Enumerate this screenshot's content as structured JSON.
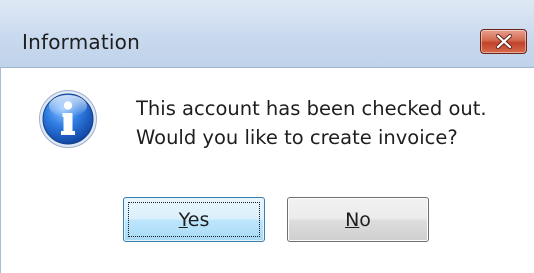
{
  "window": {
    "title": "Information",
    "close_icon": "close-x-icon"
  },
  "message": {
    "icon": "information-icon",
    "line1": "This account has been checked out.",
    "line2": "Would you like to create invoice?"
  },
  "buttons": {
    "yes": {
      "mnemonic": "Y",
      "rest": "es"
    },
    "no": {
      "mnemonic": "N",
      "rest": "o"
    }
  },
  "colors": {
    "titlebar": "#c9d9ee",
    "close_button": "#c2432a",
    "info_icon": "#1f63c7"
  }
}
